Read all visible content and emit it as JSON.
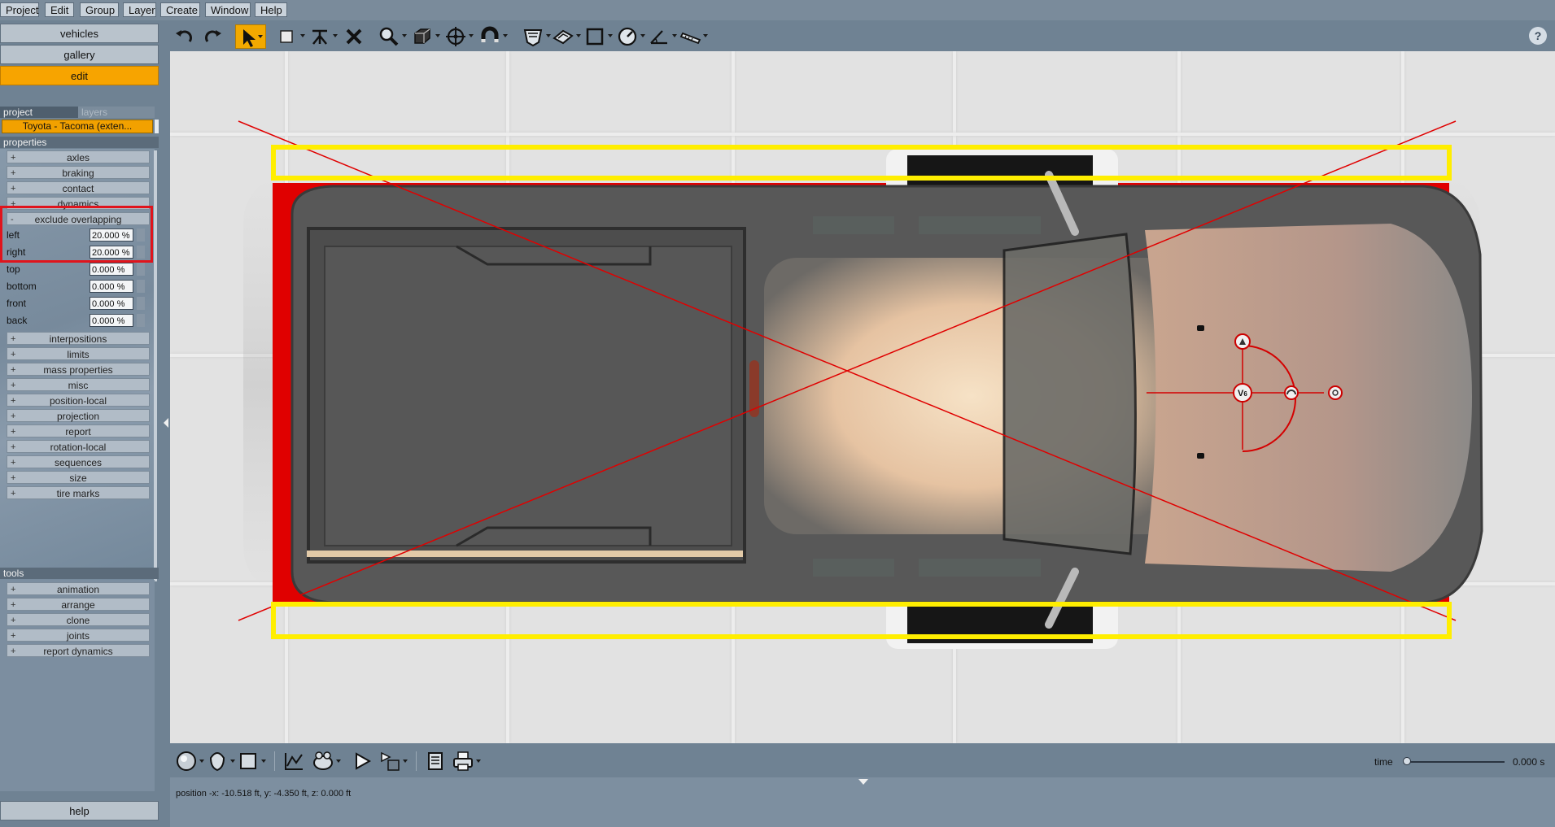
{
  "menu": [
    "Project",
    "Edit",
    "Group",
    "Layer",
    "Create",
    "Window",
    "Help"
  ],
  "toolbar": {
    "icons": [
      "undo-icon",
      "redo-icon",
      "select-arrow-icon",
      "rectangle-select-icon",
      "tripod-icon",
      "delete-icon",
      "zoom-icon",
      "box-3d-icon",
      "target-icon",
      "magnet-icon",
      "shield-icon",
      "plane-icon",
      "frame-icon",
      "gauge-icon",
      "angle-icon",
      "ruler-icon"
    ],
    "help_glyph": "?"
  },
  "left": {
    "vehicles": "vehicles",
    "gallery": "gallery",
    "edit": "edit",
    "tab_project": "project",
    "tab_layers": "layers",
    "project_value": "Toyota - Tacoma (exten...",
    "properties_label": "properties",
    "properties_before": [
      {
        "sign": "+",
        "label": "axles"
      },
      {
        "sign": "+",
        "label": "braking"
      },
      {
        "sign": "+",
        "label": "contact"
      },
      {
        "sign": "+",
        "label": "dynamics"
      }
    ],
    "exclude": {
      "sign": "-",
      "label": "exclude overlapping"
    },
    "fields": [
      {
        "label": "left",
        "value": "20.000 %"
      },
      {
        "label": "right",
        "value": "20.000 %"
      },
      {
        "label": "top",
        "value": "0.000 %"
      },
      {
        "label": "bottom",
        "value": "0.000 %"
      },
      {
        "label": "front",
        "value": "0.000 %"
      },
      {
        "label": "back",
        "value": "0.000 %"
      }
    ],
    "properties_after": [
      {
        "sign": "+",
        "label": "interpositions"
      },
      {
        "sign": "+",
        "label": "limits"
      },
      {
        "sign": "+",
        "label": "mass properties"
      },
      {
        "sign": "+",
        "label": "misc"
      },
      {
        "sign": "+",
        "label": "position-local"
      },
      {
        "sign": "+",
        "label": "projection"
      },
      {
        "sign": "+",
        "label": "report"
      },
      {
        "sign": "+",
        "label": "rotation-local"
      },
      {
        "sign": "+",
        "label": "sequences"
      },
      {
        "sign": "+",
        "label": "size"
      },
      {
        "sign": "+",
        "label": "tire marks"
      }
    ],
    "tools_label": "tools",
    "tools": [
      {
        "sign": "+",
        "label": "animation"
      },
      {
        "sign": "+",
        "label": "arrange"
      },
      {
        "sign": "+",
        "label": "clone"
      },
      {
        "sign": "+",
        "label": "joints"
      },
      {
        "sign": "+",
        "label": "report dynamics"
      }
    ],
    "help": "help"
  },
  "viewport": {
    "vehicle_marker": "V",
    "vehicle_marker_sub": "6"
  },
  "bottom": {
    "icons": [
      "sphere-icon",
      "drop-icon",
      "square-icon",
      "graph-icon",
      "camera-icon",
      "play-icon",
      "sequence-icon",
      "page-icon",
      "print-icon"
    ],
    "time_label": "time",
    "time_value": "0.000 s",
    "time_position": 0
  },
  "status": {
    "position": "position -x: -10.518 ft, y: -4.350 ft, z: 0.000 ft"
  },
  "colors": {
    "accent": "#f7a400",
    "highlight": "#e0141c",
    "overlap": "#e00000",
    "yellow": "#ffee00"
  }
}
